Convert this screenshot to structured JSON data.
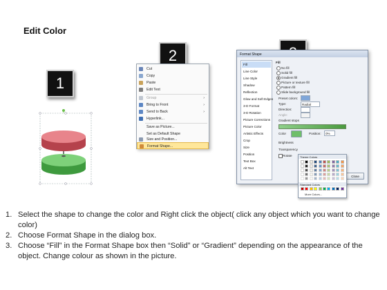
{
  "title": "Edit Color",
  "steps": {
    "one": "1",
    "two": "2",
    "three": "3"
  },
  "context_menu": {
    "items": [
      "Cut",
      "Copy",
      "Paste",
      "Edit Text",
      "Group",
      "Bring to Front",
      "Send to Back",
      "Hyperlink...",
      "Save as Picture...",
      "Set as Default Shape",
      "Size and Position...",
      "Format Shape..."
    ]
  },
  "dialog": {
    "title": "Format Shape",
    "sidebar": [
      "Fill",
      "Line Color",
      "Line Style",
      "Shadow",
      "Reflection",
      "Glow and Soft Edges",
      "3-D Format",
      "3-D Rotation",
      "Picture Corrections",
      "Picture Color",
      "Artistic Effects",
      "Crop",
      "Size",
      "Position",
      "Text Box",
      "Alt Text"
    ],
    "section": "Fill",
    "options": [
      "No fill",
      "Solid fill",
      "Gradient fill",
      "Picture or texture fill",
      "Pattern fill",
      "Slide background fill"
    ],
    "preset_colors": "Preset colors:",
    "type_label": "Type:",
    "type_value": "Radial",
    "direction_label": "Direction:",
    "angle_label": "Angle:",
    "gradient_stops": "Gradient stops",
    "color_label": "Color",
    "position_label": "Position:",
    "position_value": "0%",
    "brightness_label": "Brightness",
    "transparency_label": "Transparency",
    "rotate_label": "Rotate",
    "close_button": "Close",
    "palette": {
      "theme_colors": "Theme Colors",
      "standard_colors": "Standard Colors",
      "more_colors": "More Colors..."
    }
  },
  "instructions": [
    {
      "num": "1.",
      "text": "Select the shape to change the color and Right click the object( click any object which you want to change color)"
    },
    {
      "num": "2.",
      "text": "Choose Format Shape in the dialog box."
    },
    {
      "num": "3.",
      "text": "Choose “Fill” in the Format Shape box then “Solid” or “Gradient” depending on the appearance of the object. Change colour as shown in the picture."
    }
  ],
  "colors": {
    "red_disc": "#d9636c",
    "green_disc": "#5cb85c",
    "highlight": "#ffe79a",
    "dialog_bg": "#eef1f6"
  }
}
